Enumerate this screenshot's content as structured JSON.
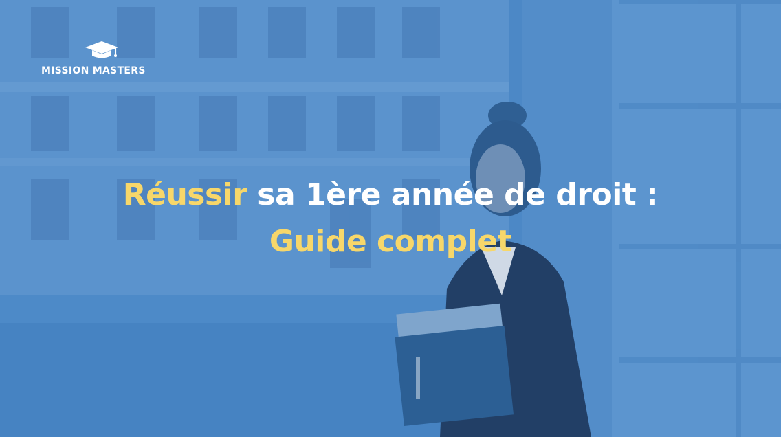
{
  "brand": {
    "name": "MISSION MASTERS",
    "icon": "graduation-cap-icon"
  },
  "headline": {
    "line1_accent": "Réussir",
    "line1_rest": " sa 1ère année de droit :",
    "line2_accent": "Guide complet"
  },
  "colors": {
    "overlay_blue": "#4a86c4",
    "accent_yellow": "#f7d76a",
    "text_white": "#ffffff"
  }
}
